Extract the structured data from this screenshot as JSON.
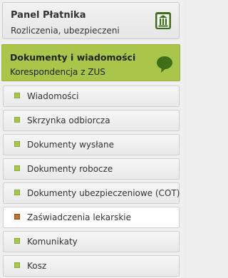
{
  "panel": {
    "title": "Panel Płatnika",
    "subtitle": "Rozliczenia, ubezpieczeni",
    "icon": "building-icon"
  },
  "docs": {
    "title": "Dokumenty i wiadomości",
    "subtitle": "Korespondencja z ZUS",
    "icon": "speech-bubble-icon"
  },
  "menu": {
    "items": [
      {
        "label": "Wiadomości"
      },
      {
        "label": "Skrzynka odbiorcza"
      },
      {
        "label": "Dokumenty wysłane"
      },
      {
        "label": "Dokumenty robocze"
      },
      {
        "label": "Dokumenty ubezpieczeniowe (COT)"
      },
      {
        "label": "Zaświadczenia lekarskie"
      },
      {
        "label": "Komunikaty"
      },
      {
        "label": "Kosz"
      }
    ],
    "active_index": 5
  },
  "colors": {
    "accent_green": "#a8c64a",
    "icon_dark_green": "#3f6e1a",
    "active_bullet": "#b9733a"
  }
}
